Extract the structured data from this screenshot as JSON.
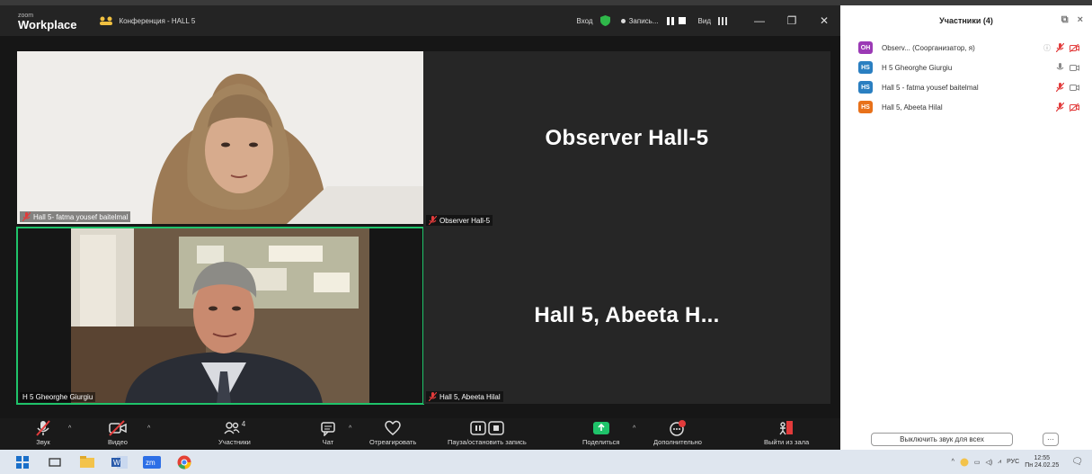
{
  "titlebar": {
    "brand_small": "zoom",
    "brand": "Workplace",
    "meeting_title": "Конференция - HALL 5",
    "enter": "Вход",
    "record": "Запись...",
    "view": "Вид"
  },
  "tiles": [
    {
      "label": "Hall 5- fatma yousef baitelmal"
    },
    {
      "label": "H 5 Gheorghe Giurgiu"
    },
    {
      "name": "Observer  Hall-5",
      "label": "Observer  Hall-5"
    },
    {
      "name": "Hall 5, Abeeta H...",
      "label": "Hall 5, Abeeta Hilal"
    }
  ],
  "participants_panel": {
    "title": "Участники (4)",
    "items": [
      {
        "initials": "OH",
        "name": "Observ...  (Соорганизатор, я)",
        "color": "#9b3ab5"
      },
      {
        "initials": "HS",
        "name": "H 5 Gheorghe Giurgiu",
        "color": "#2a7fc1"
      },
      {
        "initials": "HS",
        "name": "Hall 5 - fatma yousef baitelmal",
        "color": "#2a7fc1"
      },
      {
        "initials": "HS",
        "name": "Hall 5, Abeeta Hilal",
        "color": "#e8711a"
      }
    ],
    "mute_all": "Выключить звук для всех",
    "more": "···"
  },
  "toolbar": {
    "audio": "Звук",
    "video": "Видео",
    "participants": "Участники",
    "participants_count": "4",
    "chat": "Чат",
    "react": "Отреагировать",
    "record": "Пауза/остановить запись",
    "share": "Поделиться",
    "more": "Дополнительно",
    "leave": "Выйти из зала"
  },
  "taskbar": {
    "lang": "РУС",
    "time": "12:55",
    "date": "Пн 24.02.25"
  }
}
